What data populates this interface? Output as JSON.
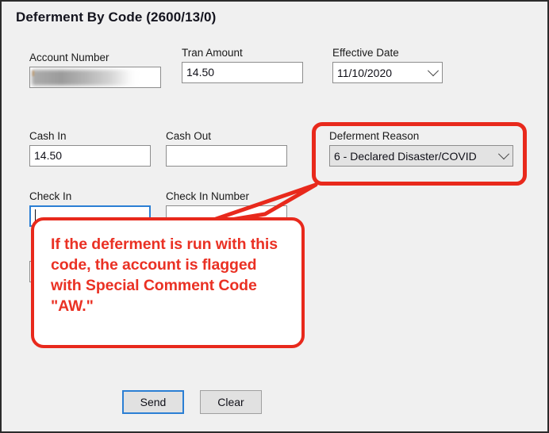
{
  "window": {
    "title": "Deferment By Code (2600/13/0)",
    "background_color": "#f0f0f0",
    "border_color": "#2b2b2b"
  },
  "form": {
    "account_number": {
      "label": "Account Number",
      "value": "",
      "redacted": true
    },
    "tran_amount": {
      "label": "Tran Amount",
      "value": "14.50"
    },
    "effective_date": {
      "label": "Effective Date",
      "value": "11/10/2020",
      "arrow": "chevron-down-icon"
    },
    "cash_in": {
      "label": "Cash In",
      "value": "14.50"
    },
    "cash_out": {
      "label": "Cash Out",
      "value": ""
    },
    "deferment_reason": {
      "label": "Deferment Reason",
      "value": "6 - Declared Disaster/COVID",
      "arrow": "chevron-down-icon"
    },
    "check_in": {
      "label": "Check In",
      "value": "",
      "focused": true
    },
    "check_in_number": {
      "label": "Check In Number",
      "value": ""
    }
  },
  "buttons": {
    "send": "Send",
    "clear": "Clear"
  },
  "annotation": {
    "color": "#e8291c",
    "text_color": "#ea3124",
    "callout_text": "If the deferment is run with this code, the account is flagged with Special Comment Code \"AW.\""
  }
}
